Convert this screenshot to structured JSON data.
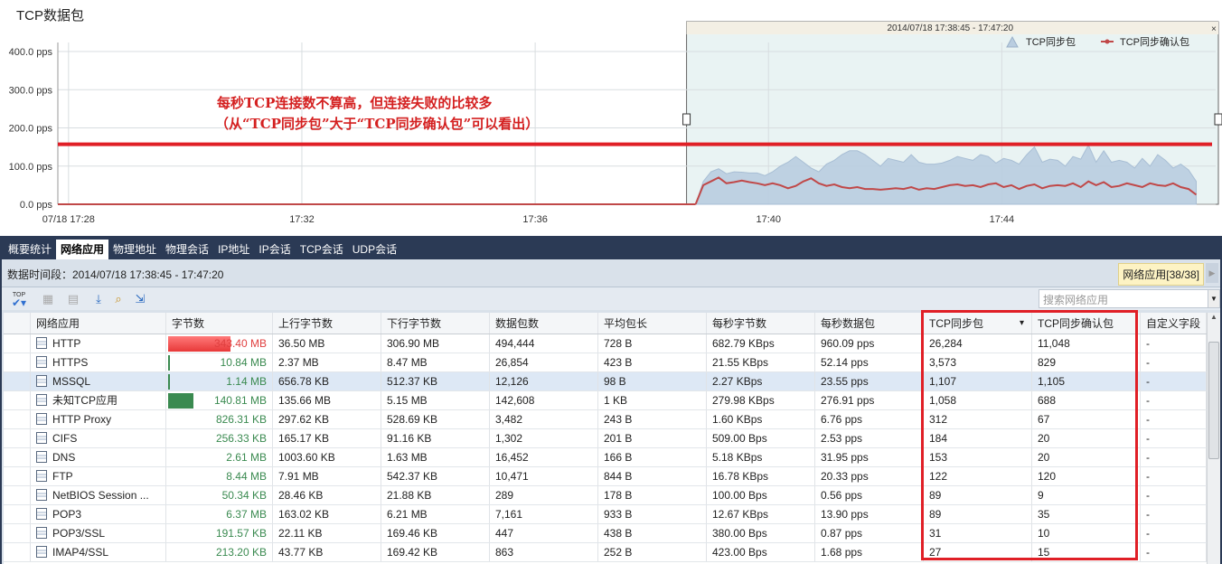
{
  "chart_title": "TCP数据包",
  "annotation": {
    "line1": "每秒TCP连接数不算高，但连接失败的比较多",
    "line2": "（从“TCP同步包”大于“TCP同步确认包”可以看出）",
    "threshold_pps": 157
  },
  "chart_data": {
    "type": "area",
    "title": "TCP数据包",
    "selection_label": "2014/07/18  17:38:45 - 17:47:20",
    "y_ticks": [
      "0.0 pps",
      "100.0 pps",
      "200.0 pps",
      "300.0 pps",
      "400.0 pps"
    ],
    "ylim": [
      0,
      400
    ],
    "x_ticks": [
      "07/18 17:28",
      "17:32",
      "17:36",
      "17:40",
      "17:44"
    ],
    "x_range": [
      "17:27:49",
      "17:47:40"
    ],
    "data_start": "17:38:45",
    "data_end": "17:47:20",
    "grid": true,
    "legend": "top-right",
    "series": [
      {
        "name": "TCP同步包",
        "type": "area",
        "color": "#b9cde0",
        "values": [
          0,
          60,
          85,
          93,
          80,
          85,
          84,
          82,
          82,
          75,
          85,
          100,
          110,
          125,
          110,
          95,
          85,
          105,
          115,
          130,
          140,
          140,
          130,
          115,
          100,
          120,
          115,
          110,
          130,
          110,
          105,
          105,
          108,
          115,
          125,
          120,
          115,
          130,
          125,
          108,
          120,
          115,
          105,
          130,
          150,
          110,
          118,
          115,
          100,
          125,
          118,
          155,
          110,
          140,
          110,
          115,
          110,
          95,
          120,
          100,
          130,
          115,
          95,
          105,
          90,
          60
        ]
      },
      {
        "name": "TCP同步确认包",
        "type": "line",
        "color": "#c04848",
        "values": [
          0,
          50,
          60,
          70,
          55,
          58,
          62,
          58,
          55,
          50,
          55,
          50,
          42,
          48,
          60,
          68,
          55,
          48,
          52,
          45,
          42,
          45,
          40,
          40,
          38,
          40,
          42,
          40,
          45,
          38,
          42,
          40,
          45,
          50,
          52,
          48,
          50,
          45,
          52,
          55,
          45,
          50,
          40,
          48,
          52,
          42,
          48,
          50,
          48,
          55,
          45,
          60,
          50,
          58,
          45,
          48,
          55,
          50,
          45,
          55,
          50,
          48,
          55,
          45,
          40,
          25
        ]
      }
    ]
  },
  "tabs": [
    "概要统计",
    "网络应用",
    "物理地址",
    "物理会话",
    "IP地址",
    "IP会话",
    "TCP会话",
    "UDP会话"
  ],
  "active_tab": 1,
  "period": "数据时间段：2014/07/18  17:38:45 - 17:47:20",
  "count_badge": "网络应用[38/38]",
  "search_placeholder": "搜索网络应用",
  "toolbar": {
    "top": "TOP"
  },
  "columns": [
    "网络应用",
    "字节数",
    "上行字节数",
    "下行字节数",
    "数据包数",
    "平均包长",
    "每秒字节数",
    "每秒数据包",
    "TCP同步包",
    "TCP同步确认包",
    "自定义字段"
  ],
  "sort_column": "TCP同步包",
  "rows": [
    [
      "HTTP",
      "343.40 MB",
      "36.50 MB",
      "306.90 MB",
      "494,444",
      "728 B",
      "682.79 KBps",
      "960.09 pps",
      "26,284",
      "11,048",
      "-"
    ],
    [
      "HTTPS",
      "10.84 MB",
      "2.37 MB",
      "8.47 MB",
      "26,854",
      "423 B",
      "21.55 KBps",
      "52.14 pps",
      "3,573",
      "829",
      "-"
    ],
    [
      "MSSQL",
      "1.14 MB",
      "656.78 KB",
      "512.37 KB",
      "12,126",
      "98 B",
      "2.27 KBps",
      "23.55 pps",
      "1,107",
      "1,105",
      "-"
    ],
    [
      "未知TCP应用",
      "140.81 MB",
      "135.66 MB",
      "5.15 MB",
      "142,608",
      "1 KB",
      "279.98 KBps",
      "276.91 pps",
      "1,058",
      "688",
      "-"
    ],
    [
      "HTTP Proxy",
      "826.31 KB",
      "297.62 KB",
      "528.69 KB",
      "3,482",
      "243 B",
      "1.60 KBps",
      "6.76 pps",
      "312",
      "67",
      "-"
    ],
    [
      "CIFS",
      "256.33 KB",
      "165.17 KB",
      "91.16 KB",
      "1,302",
      "201 B",
      "509.00 Bps",
      "2.53 pps",
      "184",
      "20",
      "-"
    ],
    [
      "DNS",
      "2.61 MB",
      "1003.60 KB",
      "1.63 MB",
      "16,452",
      "166 B",
      "5.18 KBps",
      "31.95 pps",
      "153",
      "20",
      "-"
    ],
    [
      "FTP",
      "8.44 MB",
      "7.91 MB",
      "542.37 KB",
      "10,471",
      "844 B",
      "16.78 KBps",
      "20.33 pps",
      "122",
      "120",
      "-"
    ],
    [
      "NetBIOS Session ...",
      "50.34 KB",
      "28.46 KB",
      "21.88 KB",
      "289",
      "178 B",
      "100.00 Bps",
      "0.56 pps",
      "89",
      "9",
      "-"
    ],
    [
      "POP3",
      "6.37 MB",
      "163.02 KB",
      "6.21 MB",
      "7,161",
      "933 B",
      "12.67 KBps",
      "13.90 pps",
      "89",
      "35",
      "-"
    ],
    [
      "POP3/SSL",
      "191.57 KB",
      "22.11 KB",
      "169.46 KB",
      "447",
      "438 B",
      "380.00 Bps",
      "0.87 pps",
      "31",
      "10",
      "-"
    ],
    [
      "IMAP4/SSL",
      "213.20 KB",
      "43.77 KB",
      "169.42 KB",
      "863",
      "252 B",
      "423.00 Bps",
      "1.68 pps",
      "27",
      "15",
      "-"
    ]
  ],
  "byte_bars": [
    {
      "fraction": 0.62,
      "color": "#f04848"
    },
    {
      "fraction": 0.01,
      "color": "#3a8a50"
    },
    {
      "fraction": 0,
      "color": "#3a8a50"
    },
    {
      "fraction": 0.25,
      "color": "#3a8a50"
    }
  ],
  "selected_row": 2
}
